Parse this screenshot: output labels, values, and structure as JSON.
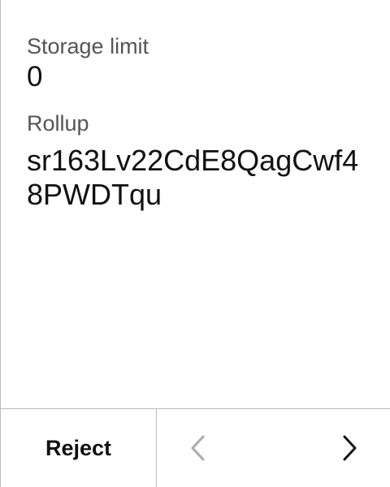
{
  "fields": {
    "storage_limit": {
      "label": "Storage limit",
      "value": "0"
    },
    "rollup": {
      "label": "Rollup",
      "value": "sr163Lv22CdE8QagCwf48PWDTqu"
    }
  },
  "footer": {
    "reject_label": "Reject",
    "prev_icon": "chevron-left-icon",
    "next_icon": "chevron-right-icon",
    "prev_enabled": false,
    "next_enabled": true
  },
  "colors": {
    "text": "#111111",
    "label": "#555555",
    "divider": "#bdbdbd",
    "disabled_icon": "#aaaaaa",
    "enabled_icon": "#111111"
  }
}
